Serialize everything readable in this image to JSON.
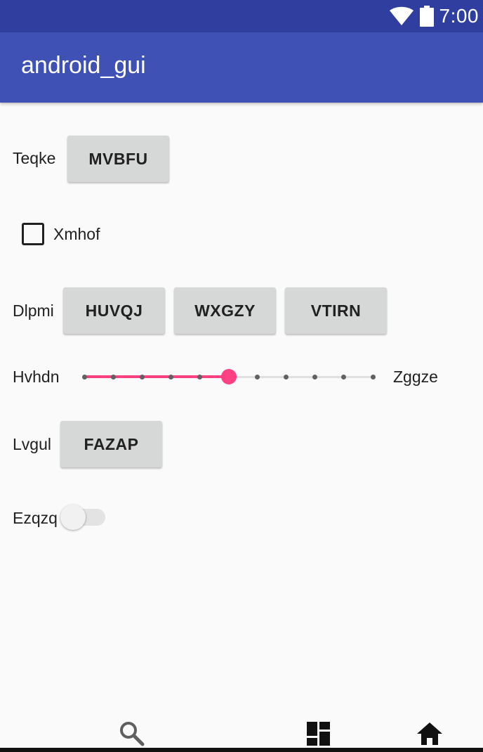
{
  "status_bar": {
    "time": "7:00",
    "icons": [
      "wifi-icon",
      "battery-icon"
    ]
  },
  "app_bar": {
    "title": "android_gui"
  },
  "rows": {
    "teqke": {
      "label": "Teqke",
      "button": "MVBFU"
    },
    "checkbox": {
      "label": "Xmhof",
      "checked": false
    },
    "dlpmi": {
      "label": "Dlpmi",
      "buttons": [
        "HUVQJ",
        "WXGZY",
        "VTIRN"
      ]
    },
    "slider": {
      "left_label": "Hvhdn",
      "right_label": "Zggze",
      "steps": 10,
      "value": 5,
      "accent": "#ff4081"
    },
    "lvgul": {
      "label": "Lvgul",
      "button": "FAZAP"
    },
    "switch": {
      "label": "Ezqzq",
      "on": false
    }
  },
  "nav_bar": {
    "icons": [
      "search-icon",
      "dashboard-icon",
      "home-icon"
    ]
  },
  "colors": {
    "status_bar": "#303f9f",
    "app_bar": "#3f51b5",
    "accent": "#ff4081",
    "background": "#fafafa",
    "button": "#d6d7d7"
  }
}
